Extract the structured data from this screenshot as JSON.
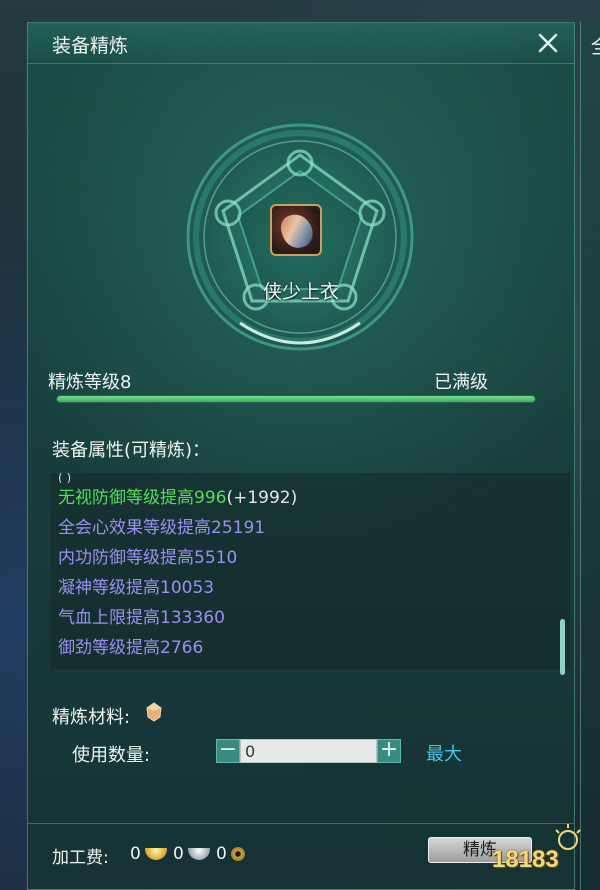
{
  "window": {
    "title": "装备精炼",
    "side_title": "全"
  },
  "item": {
    "name": "侠少上衣",
    "icon": "robe-icon"
  },
  "refine": {
    "level_label": "精炼等级8",
    "status": "已满级",
    "progress": 1.0
  },
  "attributes": {
    "heading": "装备属性(可精炼)：",
    "lines": [
      {
        "text": "无视防御等级提高996",
        "bonus": "(+1992)",
        "color": "#55de57"
      },
      {
        "text": "全会心效果等级提高25191",
        "color": "#9b90f0"
      },
      {
        "text": "内功防御等级提高5510",
        "color": "#9b90f0"
      },
      {
        "text": "凝神等级提高10053",
        "color": "#9b90f0"
      },
      {
        "text": "气血上限提高133360",
        "color": "#9b90f0"
      },
      {
        "text": "御劲等级提高2766",
        "color": "#9b90f0"
      }
    ]
  },
  "material": {
    "label": "精炼材料:",
    "icon": "refine-stone-icon"
  },
  "quantity": {
    "label": "使用数量:",
    "value": "0",
    "minus": "−",
    "plus": "+",
    "max_label": "最大"
  },
  "fee": {
    "label": "加工费:",
    "gold": "0",
    "silver": "0",
    "coin": "0"
  },
  "buttons": {
    "refine_label": "精炼"
  },
  "watermark": {
    "text": "18183"
  },
  "colors": {
    "accent_green": "#55de57",
    "attribute_purple": "#9b90f0",
    "link_blue": "#49c3e6",
    "panel_teal": "#1a4e48"
  }
}
